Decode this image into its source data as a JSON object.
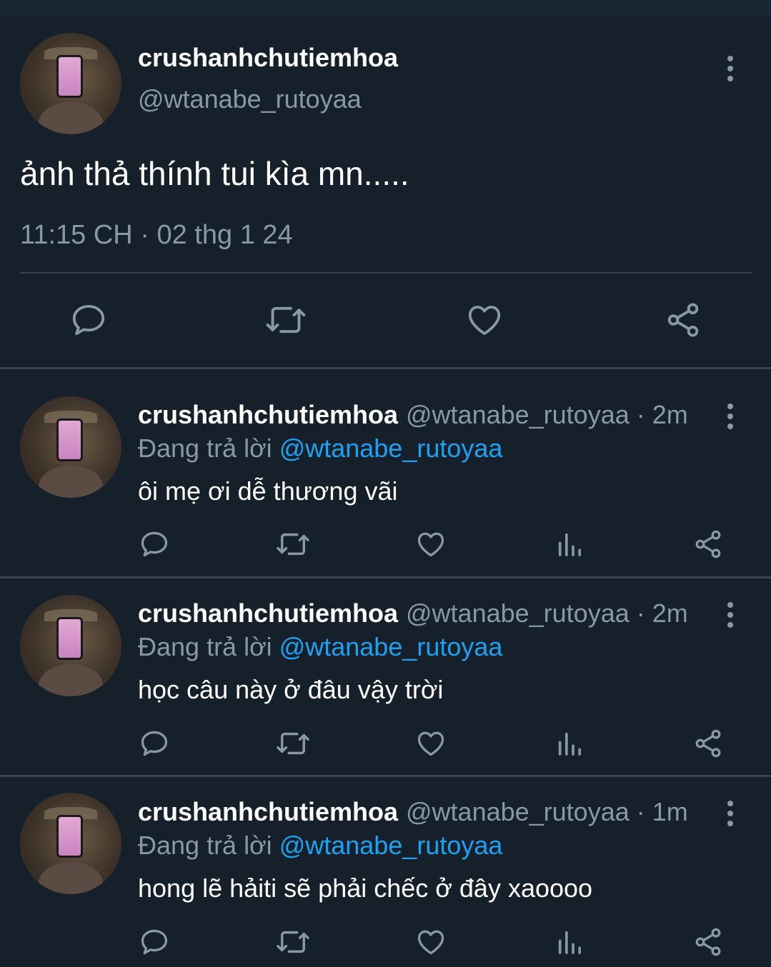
{
  "main_tweet": {
    "display_name": "crushanhchutiemhoa",
    "handle": "@wtanabe_rutoyaa",
    "text": "ảnh thả thính tui kìa mn.....",
    "timestamp": "11:15 CH · 02 thg 1 24",
    "icons": [
      "comment-icon",
      "retweet-icon",
      "heart-icon",
      "share-icon",
      "more-icon"
    ]
  },
  "replies": [
    {
      "display_name": "crushanhchutiemhoa",
      "handle_time": "@wtanabe_rutoyaa · 2m",
      "replying_prefix": "Đang trả lời ",
      "replying_to": "@wtanabe_rutoyaa",
      "text": "ôi mẹ ơi dễ thương vãi"
    },
    {
      "display_name": "crushanhchutiemhoa",
      "handle_time": "@wtanabe_rutoyaa · 2m",
      "replying_prefix": "Đang trả lời ",
      "replying_to": "@wtanabe_rutoyaa",
      "text": "học câu này ở đâu vậy trời"
    },
    {
      "display_name": "crushanhchutiemhoa",
      "handle_time": "@wtanabe_rutoyaa · 1m",
      "replying_prefix": "Đang trả lời ",
      "replying_to": "@wtanabe_rutoyaa",
      "text": "hong lẽ hảiti sẽ phải chếc ở đây xaoooo"
    }
  ],
  "reply_icons": [
    "comment-icon",
    "retweet-icon",
    "heart-icon",
    "views-icon",
    "share-icon"
  ],
  "colors": {
    "background": "#15202b",
    "secondary_text": "#8899a6",
    "link": "#1da1f2",
    "divider": "#38444d"
  }
}
